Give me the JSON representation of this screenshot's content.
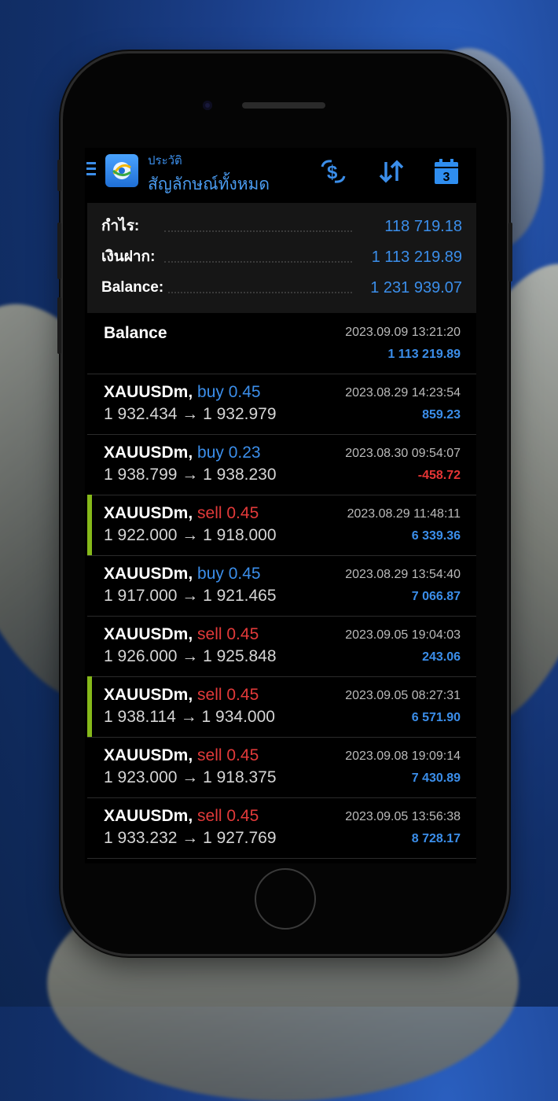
{
  "header": {
    "subtitle": "ประวัติ",
    "title": "สัญลักษณ์ทั้งหมด",
    "icons": [
      "menu-icon",
      "app-logo-icon",
      "dollar-exchange-icon",
      "sort-icon",
      "calendar-icon"
    ],
    "calendar_day": "3"
  },
  "summary": {
    "profit_label": "กำไร:",
    "profit_value": "118 719.18",
    "deposit_label": "เงินฝาก:",
    "deposit_value": "1 113 219.89",
    "balance_label": "Balance:",
    "balance_value": "1 231 939.07"
  },
  "balance_entry": {
    "label": "Balance",
    "time": "2023.09.09 13:21:20",
    "amount": "1 113 219.89"
  },
  "trades": [
    {
      "symbol": "XAUUSDm,",
      "side": "buy",
      "volume": "0.45",
      "prices": "1 932.434 → 1 932.979",
      "time": "2023.08.29 14:23:54",
      "profit": "859.23",
      "highlight": false
    },
    {
      "symbol": "XAUUSDm,",
      "side": "buy",
      "volume": "0.23",
      "prices": "1 938.799 → 1 938.230",
      "time": "2023.08.30 09:54:07",
      "profit": "-458.72",
      "highlight": false
    },
    {
      "symbol": "XAUUSDm,",
      "side": "sell",
      "volume": "0.45",
      "prices": "1 922.000 → 1 918.000",
      "time": "2023.08.29 11:48:11",
      "profit": "6 339.36",
      "highlight": true
    },
    {
      "symbol": "XAUUSDm,",
      "side": "buy",
      "volume": "0.45",
      "prices": "1 917.000 → 1 921.465",
      "time": "2023.08.29 13:54:40",
      "profit": "7 066.87",
      "highlight": false
    },
    {
      "symbol": "XAUUSDm,",
      "side": "sell",
      "volume": "0.45",
      "prices": "1 926.000 → 1 925.848",
      "time": "2023.09.05 19:04:03",
      "profit": "243.06",
      "highlight": false
    },
    {
      "symbol": "XAUUSDm,",
      "side": "sell",
      "volume": "0.45",
      "prices": "1 938.114 → 1 934.000",
      "time": "2023.09.05 08:27:31",
      "profit": "6 571.90",
      "highlight": true
    },
    {
      "symbol": "XAUUSDm,",
      "side": "sell",
      "volume": "0.45",
      "prices": "1 923.000 → 1 918.375",
      "time": "2023.09.08 19:09:14",
      "profit": "7 430.89",
      "highlight": false
    },
    {
      "symbol": "XAUUSDm,",
      "side": "sell",
      "volume": "0.45",
      "prices": "1 933.232 → 1 927.769",
      "time": "2023.09.05 13:56:38",
      "profit": "8 728.17",
      "highlight": false
    }
  ],
  "colors": {
    "accent": "#3b8eea",
    "sell": "#e23a3a",
    "negative": "#e53535",
    "highlight_bar": "#86b91a"
  }
}
